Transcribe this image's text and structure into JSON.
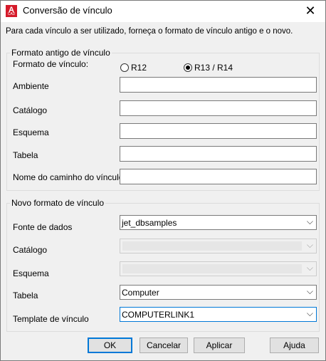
{
  "window": {
    "title": "Conversão de vínculo",
    "icon": "autocad-icon",
    "icon_letter": "A",
    "icon_sub": "CAD"
  },
  "instruction": "Para cada vínculo a ser utilizado, forneça o formato de vínculo antigo e o novo.",
  "old_format": {
    "legend": "Formato antigo de vínculo",
    "format_label": "Formato de vínculo:",
    "radio_r12": {
      "label": "R12",
      "selected": false
    },
    "radio_r13": {
      "label": "R13 / R14",
      "selected": true
    },
    "fields": [
      {
        "label": "Ambiente",
        "value": ""
      },
      {
        "label": "Catálogo",
        "value": ""
      },
      {
        "label": "Esquema",
        "value": ""
      },
      {
        "label": "Tabela",
        "value": ""
      },
      {
        "label": "Nome do caminho do vínculo",
        "value": ""
      }
    ]
  },
  "new_format": {
    "legend": "Novo formato de vínculo",
    "fields": [
      {
        "label": "Fonte de dados",
        "value": "jet_dbsamples",
        "enabled": true
      },
      {
        "label": "Catálogo",
        "value": "",
        "enabled": false
      },
      {
        "label": "Esquema",
        "value": "",
        "enabled": false
      },
      {
        "label": "Tabela",
        "value": "Computer",
        "enabled": true
      },
      {
        "label": "Template de vínculo",
        "value": "COMPUTERLINK1",
        "enabled": true
      }
    ]
  },
  "buttons": {
    "ok": "OK",
    "cancel": "Cancelar",
    "apply": "Aplicar",
    "help": "Ajuda"
  },
  "colors": {
    "accent": "#0078d7",
    "app_icon": "#d51a2a"
  }
}
